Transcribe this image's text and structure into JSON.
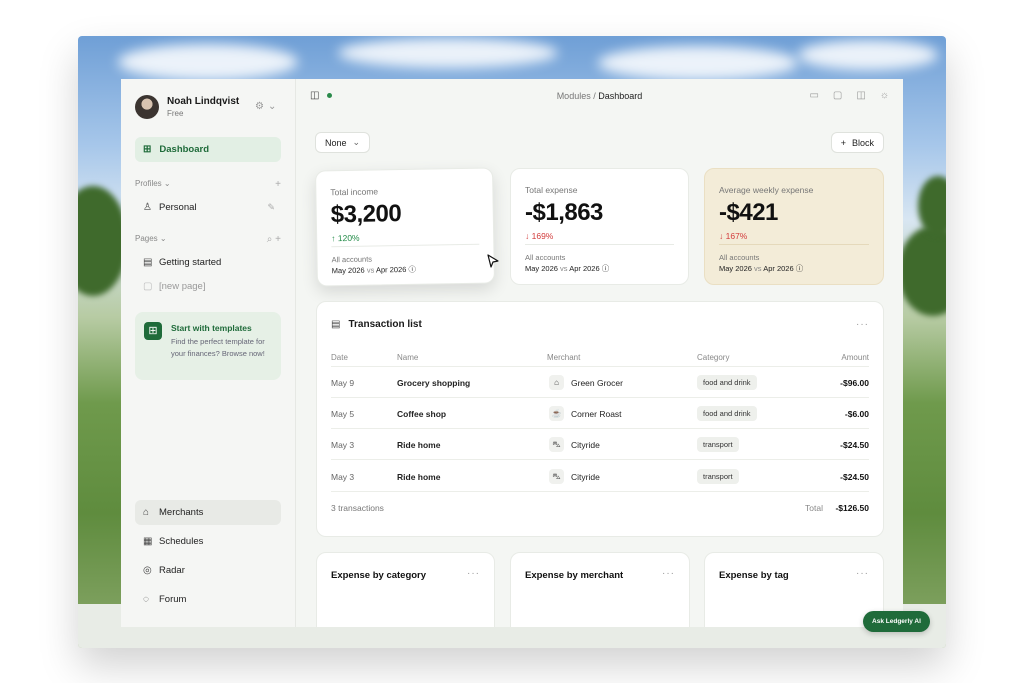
{
  "user": {
    "name": "Noah Lindqvist",
    "plan": "Free"
  },
  "nav": {
    "dashboard": "Dashboard"
  },
  "profiles": {
    "header": "Profiles",
    "items": [
      {
        "label": "Personal"
      }
    ]
  },
  "pages": {
    "header": "Pages",
    "items": [
      {
        "label": "Getting started"
      },
      {
        "label": "[new page]"
      }
    ]
  },
  "templates": {
    "title": "Start with templates",
    "description": "Find the perfect template for your finances? Browse now!"
  },
  "bottom_nav": [
    {
      "label": "Merchants"
    },
    {
      "label": "Schedules"
    },
    {
      "label": "Radar"
    },
    {
      "label": "Forum"
    }
  ],
  "breadcrumb": {
    "parent": "Modules",
    "separator": "/",
    "current": "Dashboard"
  },
  "toolbar": {
    "filter_label": "None",
    "add_block_label": "Block"
  },
  "kpis": [
    {
      "label": "Total income",
      "value": "$3,200",
      "delta": "120%",
      "direction": "up",
      "accounts": "All accounts",
      "from": "May 2026",
      "vs": "vs",
      "to": "Apr 2026"
    },
    {
      "label": "Total expense",
      "value": "-$1,863",
      "delta": "169%",
      "direction": "down",
      "accounts": "All accounts",
      "from": "May 2026",
      "vs": "vs",
      "to": "Apr 2026"
    },
    {
      "label": "Average weekly expense",
      "value": "-$421",
      "delta": "167%",
      "direction": "down",
      "accounts": "All accounts",
      "from": "May 2026",
      "vs": "vs",
      "to": "Apr 2026"
    }
  ],
  "transactions": {
    "title": "Transaction list",
    "columns": {
      "date": "Date",
      "name": "Name",
      "merchant": "Merchant",
      "category": "Category",
      "amount": "Amount"
    },
    "rows": [
      {
        "date": "May 9",
        "name": "Grocery shopping",
        "merchant": "Green Grocer",
        "category": "food and drink",
        "amount": "-$96.00"
      },
      {
        "date": "May 5",
        "name": "Coffee shop",
        "merchant": "Corner Roast",
        "category": "food and drink",
        "amount": "-$6.00"
      },
      {
        "date": "May 3",
        "name": "Ride home",
        "merchant": "Cityride",
        "category": "transport",
        "amount": "-$24.50"
      },
      {
        "date": "May 3",
        "name": "Ride home",
        "merchant": "Cityride",
        "category": "transport",
        "amount": "-$24.50"
      }
    ],
    "count": "3 transactions",
    "total_label": "Total",
    "total": "-$126.50"
  },
  "cards": {
    "by_category": "Expense by category",
    "by_merchant": "Expense by merchant",
    "by_tag": "Expense by tag"
  },
  "assistant": {
    "label": "Ask Ledgerly AI"
  },
  "colors": {
    "accent": "#1f6b3a",
    "up": "#1f8a45",
    "down": "#d23b3b",
    "highlight_card": "#f3ecd8"
  }
}
